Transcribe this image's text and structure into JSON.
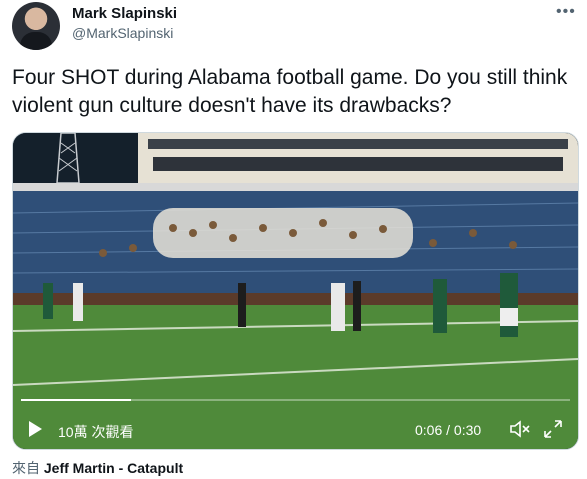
{
  "tweet": {
    "author_name": "Mark Slapinski",
    "author_handle": "@MarkSlapinski",
    "more_icon": "more-horizontal-icon",
    "text": "Four SHOT during Alabama football game. Do you still think violent gun culture doesn't have its drawbacks?"
  },
  "video": {
    "views": "10萬 次觀看",
    "time": "0:06 / 0:30",
    "progress": 0.2,
    "play_icon": "play-icon",
    "volume_icon": "volume-icon",
    "fullscreen_icon": "fullscreen-icon"
  },
  "source": {
    "prefix": "來自",
    "name": "Jeff Martin - Catapult"
  }
}
